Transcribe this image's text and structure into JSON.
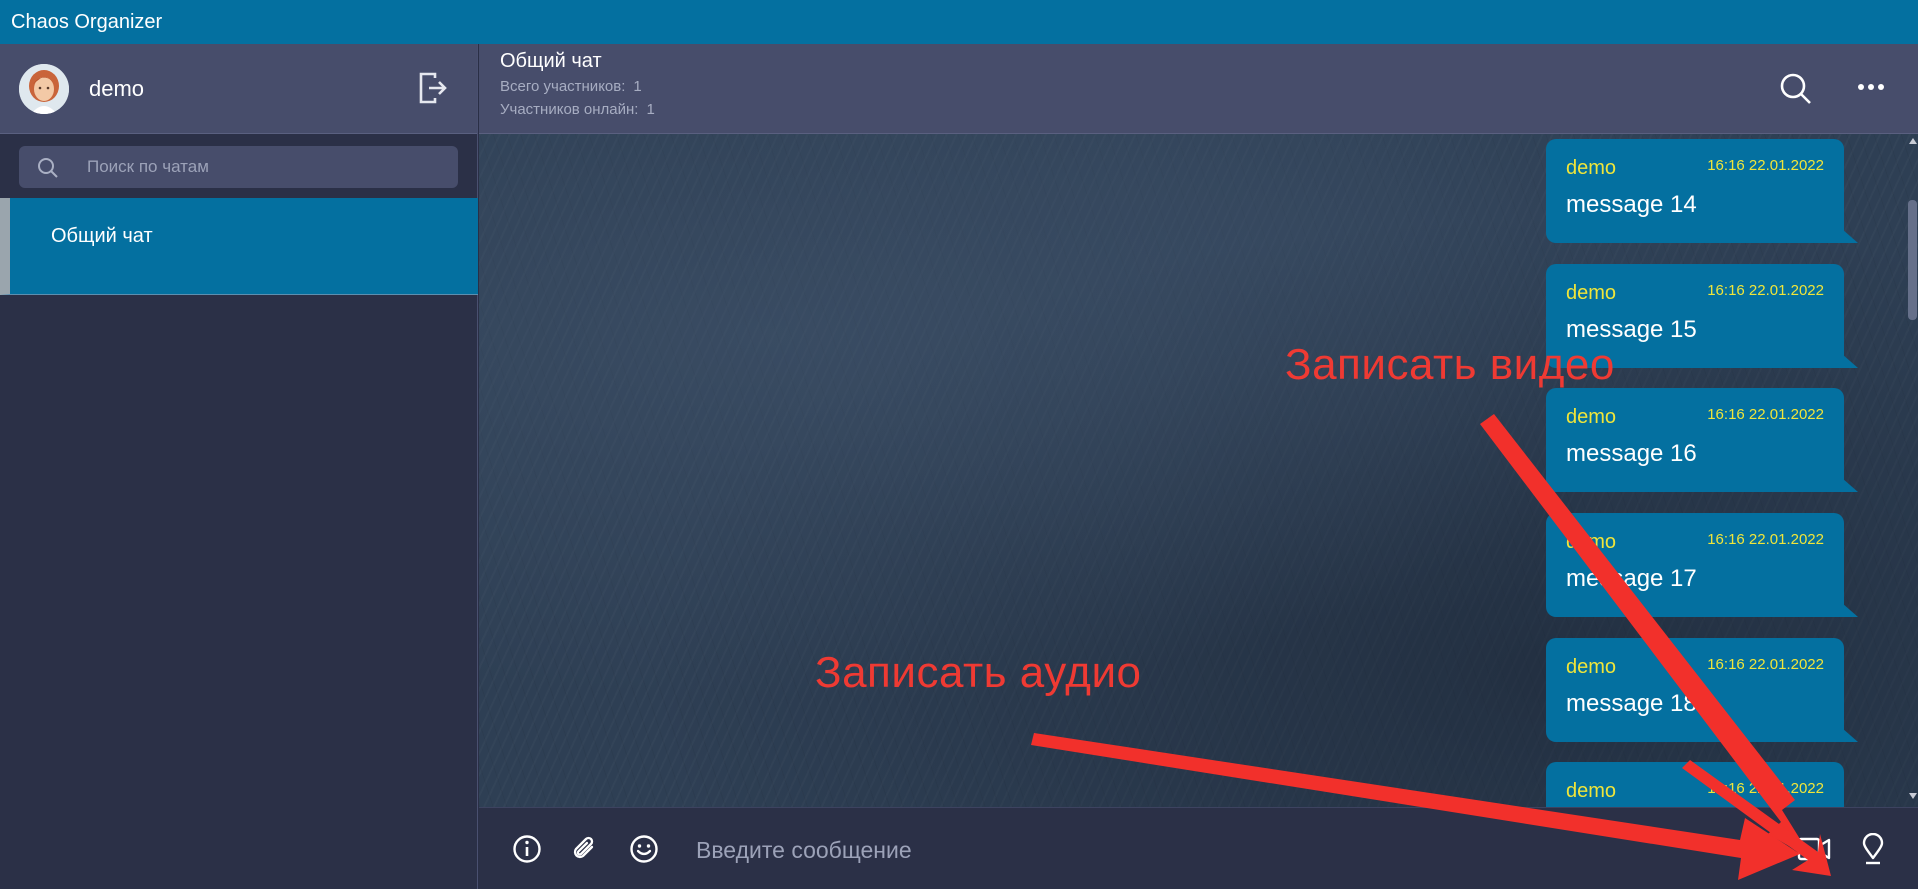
{
  "app": {
    "title": "Chaos Organizer"
  },
  "user": {
    "name": "demo"
  },
  "sidebar": {
    "search_placeholder": "Поиск по чатам",
    "chats": [
      {
        "name": "Общий чат"
      }
    ]
  },
  "chat_header": {
    "title": "Общий чат",
    "total_label": "Всего участников:",
    "total_value": "1",
    "online_label": "Участников онлайн:",
    "online_value": "1"
  },
  "messages": [
    {
      "author": "demo",
      "time": "16:16 22.01.2022",
      "text": "message 14"
    },
    {
      "author": "demo",
      "time": "16:16 22.01.2022",
      "text": "message 15"
    },
    {
      "author": "demo",
      "time": "16:16 22.01.2022",
      "text": "message 16"
    },
    {
      "author": "demo",
      "time": "16:16 22.01.2022",
      "text": "message 17"
    },
    {
      "author": "demo",
      "time": "16:16 22.01.2022",
      "text": "message 18"
    },
    {
      "author": "demo",
      "time": "16:16 22.01.2022",
      "text": ""
    }
  ],
  "composer": {
    "placeholder": "Введите сообщение"
  },
  "annotations": {
    "record_video": "Записать видео",
    "record_audio": "Записать аудио"
  },
  "colors": {
    "accent": "#0470a0",
    "author": "#f0e53a",
    "annotation": "#ef3a33"
  },
  "icons": [
    "logout-icon",
    "search-icon",
    "more-icon",
    "info-icon",
    "paperclip-icon",
    "emoji-icon",
    "microphone-icon",
    "video-camera-icon",
    "location-icon"
  ]
}
